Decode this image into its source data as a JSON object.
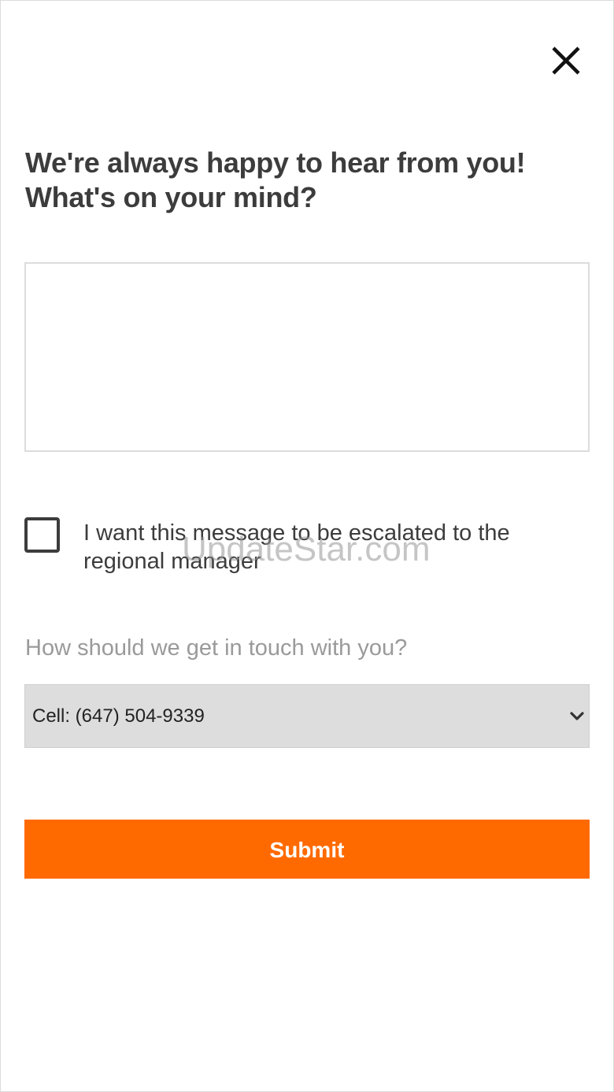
{
  "dialog": {
    "close_icon": "close-icon",
    "heading_line1": "We're always happy to hear from you!",
    "heading_line2": "What's on your mind?",
    "message_value": "",
    "escalate": {
      "checked": false,
      "label_line1": "I want this message to be escalated to the",
      "label_line2": "regional manager"
    },
    "contact": {
      "question": "How should we get in touch with you?",
      "selected_option": "Cell: (647) 504-9339",
      "chevron_icon": "chevron-down-icon"
    },
    "submit_label": "Submit"
  },
  "watermark": "UpdateStar.com",
  "colors": {
    "accent": "#ff6a00",
    "heading_text": "#3c3c3c",
    "muted_text": "#9a9a9a",
    "select_bg": "#dddddd",
    "border": "#dcdcdc"
  }
}
